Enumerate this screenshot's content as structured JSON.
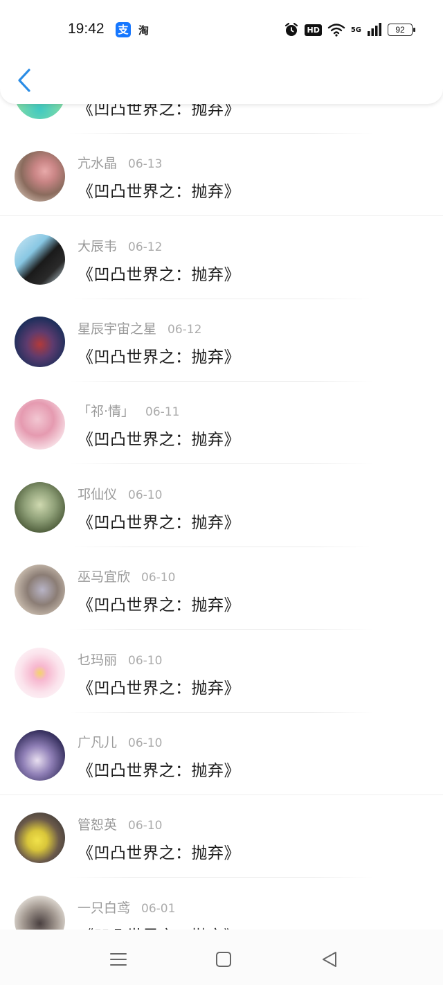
{
  "status_bar": {
    "time": "19:42",
    "app_icon_1": "支",
    "app_icon_2": "淘",
    "network": "5G",
    "hd": "HD",
    "battery": "92"
  },
  "header": {
    "back_icon": "chevron-left-icon"
  },
  "list": {
    "items": [
      {
        "name": "",
        "date": "",
        "title": "《凹凸世界之：抛弃》"
      },
      {
        "name": "亢水晶",
        "date": "06-13",
        "title": "《凹凸世界之：抛弃》"
      },
      {
        "name": "大辰韦",
        "date": "06-12",
        "title": "《凹凸世界之：抛弃》"
      },
      {
        "name": "星辰宇宙之星",
        "date": "06-12",
        "title": "《凹凸世界之：抛弃》"
      },
      {
        "name": "「祁·情」",
        "date": "06-11",
        "title": "《凹凸世界之：抛弃》"
      },
      {
        "name": "邛仙仪",
        "date": "06-10",
        "title": "《凹凸世界之：抛弃》"
      },
      {
        "name": "巫马宜欣",
        "date": "06-10",
        "title": "《凹凸世界之：抛弃》"
      },
      {
        "name": "乜玛丽",
        "date": "06-10",
        "title": "《凹凸世界之：抛弃》"
      },
      {
        "name": "广凡儿",
        "date": "06-10",
        "title": "《凹凸世界之：抛弃》"
      },
      {
        "name": "管恕英",
        "date": "06-10",
        "title": "《凹凸世界之：抛弃》"
      },
      {
        "name": "一只白鸢",
        "date": "06-01",
        "title": "《凹凸世界之：抛弃》"
      }
    ]
  },
  "navbar": {
    "menu_icon": "menu-icon",
    "home_icon": "home-icon",
    "back_icon": "back-triangle-icon"
  }
}
